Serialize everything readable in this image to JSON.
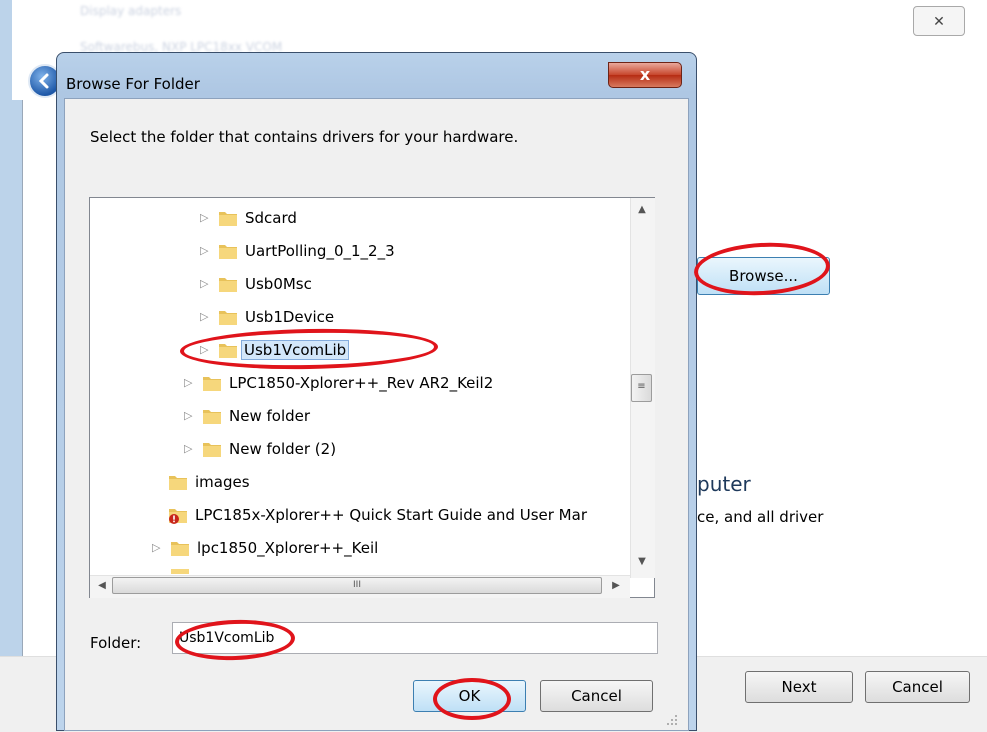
{
  "background_window": {
    "blur_line_1": "Display adapters",
    "blur_line_2": "Softwarebus, NXP LPC18xx VCOM",
    "close_glyph": "✕",
    "browse_label": "Browse...",
    "partial_heading": "puter",
    "partial_desc": "ce, and all driver",
    "next_label": "Next",
    "cancel_label": "Cancel"
  },
  "dialog": {
    "title": "Browse For Folder",
    "close_glyph": "x",
    "instruction": "Select the folder that contains drivers for your hardware.",
    "tree": {
      "items": [
        {
          "label": "Sdcard",
          "expandable": true,
          "icon": "folder-icon"
        },
        {
          "label": "UartPolling_0_1_2_3",
          "expandable": true,
          "icon": "folder-icon"
        },
        {
          "label": "Usb0Msc",
          "expandable": true,
          "icon": "folder-icon"
        },
        {
          "label": "Usb1Device",
          "expandable": true,
          "icon": "folder-icon"
        },
        {
          "label": "Usb1VcomLib",
          "expandable": true,
          "selected": true,
          "icon": "folder-icon"
        },
        {
          "label": "LPC1850-Xplorer++_Rev AR2_Keil2",
          "expandable": true,
          "icon": "folder-icon"
        },
        {
          "label": "New folder",
          "expandable": true,
          "icon": "folder-icon"
        },
        {
          "label": "New folder (2)",
          "expandable": true,
          "icon": "folder-icon"
        },
        {
          "label": "images",
          "expandable": false,
          "icon": "folder-icon"
        },
        {
          "label": "LPC185x-Xplorer++ Quick Start Guide and User Mar",
          "expandable": false,
          "icon": "warning-folder-icon"
        },
        {
          "label": "lpc1850_Xplorer++_Keil",
          "expandable": true,
          "icon": "folder-icon"
        }
      ]
    },
    "folder_label": "Folder:",
    "folder_value": "Usb1VcomLib",
    "ok_label": "OK",
    "cancel_label": "Cancel"
  },
  "colors": {
    "annotation": "#e0141b",
    "selection": "#d3e7fa",
    "title_bar": "#b9d1ea"
  }
}
